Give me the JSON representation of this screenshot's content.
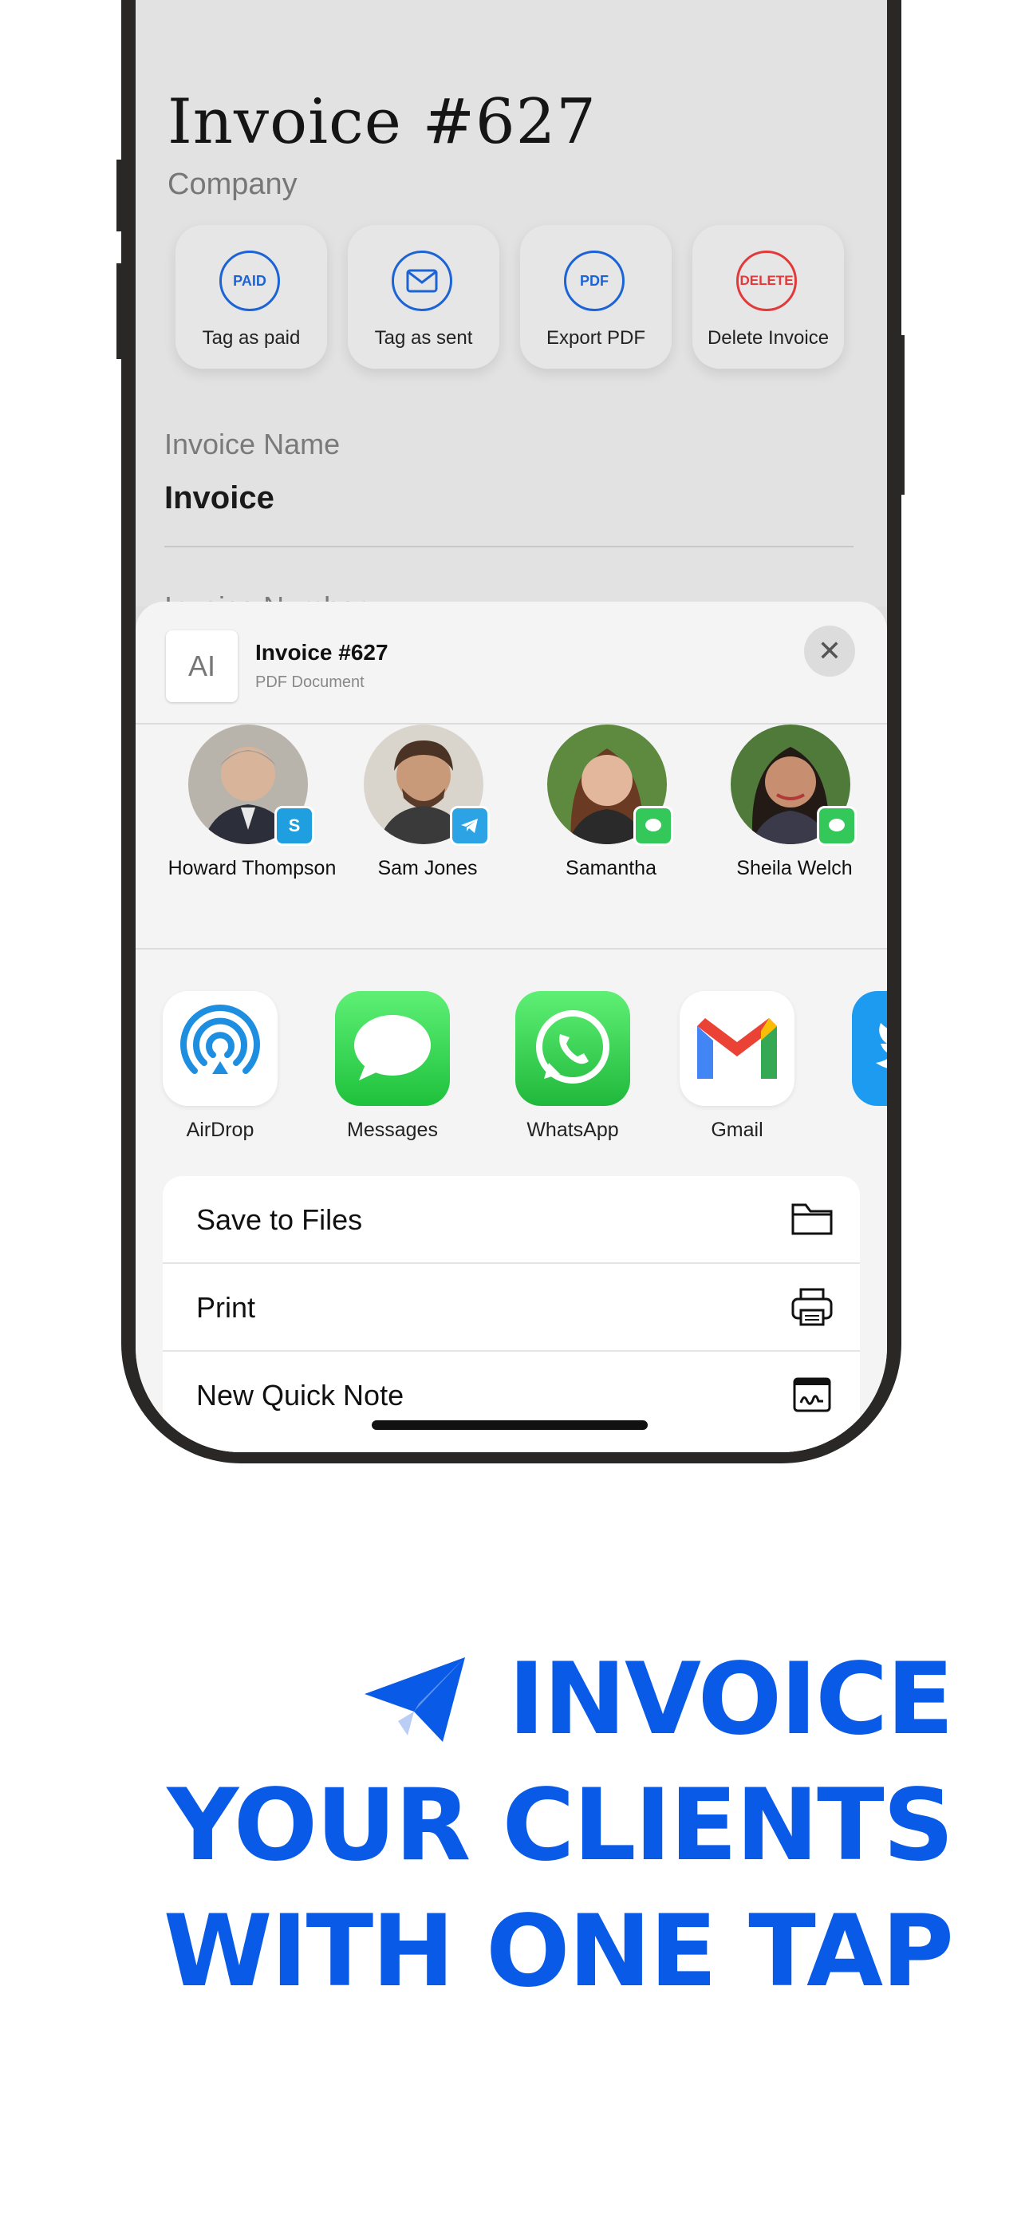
{
  "invoice": {
    "title": "Invoice #627",
    "company": "Company",
    "actions": [
      {
        "icon_text": "PAID",
        "label": "Tag as paid"
      },
      {
        "icon_text": "",
        "label": "Tag as sent"
      },
      {
        "icon_text": "PDF",
        "label": "Export PDF"
      },
      {
        "icon_text": "DELETE",
        "label": "Delete Invoice"
      }
    ],
    "field_label": "Invoice Name",
    "field_value": "Invoice",
    "field2_label": "Invoice Number"
  },
  "share": {
    "doc_title": "Invoice #627",
    "doc_subtitle": "PDF Document",
    "doc_icon": "AI",
    "contacts": [
      {
        "name": "Howard Thompson",
        "badge": "S",
        "badge_app": "skype"
      },
      {
        "name": "Sam Jones",
        "badge": "",
        "badge_app": "telegram"
      },
      {
        "name": "Samantha",
        "badge": "",
        "badge_app": "messages"
      },
      {
        "name": "Sheila Welch",
        "badge": "",
        "badge_app": "messages"
      }
    ],
    "apps": [
      {
        "name": "AirDrop"
      },
      {
        "name": "Messages"
      },
      {
        "name": "WhatsApp"
      },
      {
        "name": "Gmail"
      },
      {
        "name": "T"
      }
    ],
    "actions": [
      {
        "label": "Save to Files",
        "icon": "folder-icon"
      },
      {
        "label": "Print",
        "icon": "printer-icon"
      },
      {
        "label": "New Quick Note",
        "icon": "quick-note-icon"
      }
    ]
  },
  "tagline": {
    "line1": "INVOICE",
    "line2": "YOUR CLIENTS",
    "line3": "WITH ONE TAP"
  },
  "colors": {
    "brand_blue": "#0a5ae8",
    "action_blue": "#1c64d6",
    "delete_red": "#e23a3a"
  }
}
